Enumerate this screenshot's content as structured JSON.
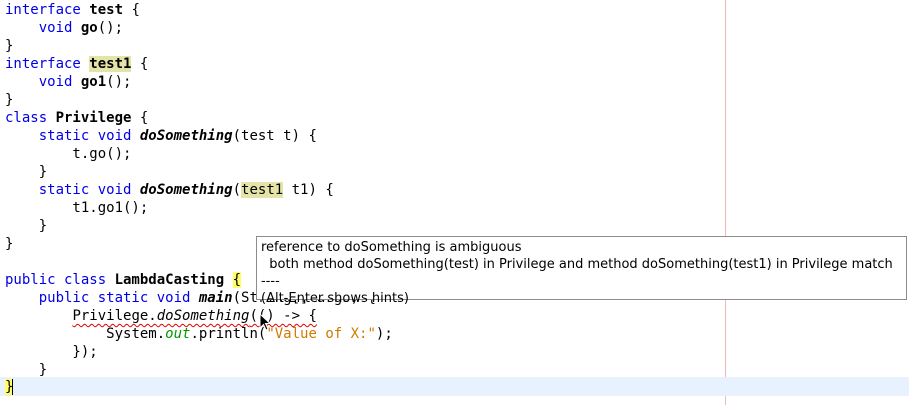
{
  "code": {
    "l1": {
      "kw": "interface ",
      "name": "test",
      "rest": " {"
    },
    "l2": {
      "indent": "    ",
      "kw": "void ",
      "name": "go",
      "rest": "();"
    },
    "l3": {
      "text": "}"
    },
    "l4": {
      "kw": "interface ",
      "name": "test1",
      "rest": " {"
    },
    "l5": {
      "indent": "    ",
      "kw": "void ",
      "name": "go1",
      "rest": "();"
    },
    "l6": {
      "text": "}"
    },
    "l7": {
      "kw": "class ",
      "name": "Privilege",
      "rest": " {"
    },
    "l8": {
      "indent": "    ",
      "kw": "static void ",
      "name": "doSomething",
      "rest": "(test t) {"
    },
    "l9": {
      "text": "        t.go();"
    },
    "l10": {
      "text": "    }"
    },
    "l11": {
      "indent": "    ",
      "kw": "static void ",
      "name": "doSomething",
      "paren": "(",
      "type": "test1",
      "rest": " t1) {"
    },
    "l12": {
      "text": "        t1.go1();"
    },
    "l13": {
      "text": "    }"
    },
    "l14": {
      "text": "}"
    },
    "l16": {
      "kw": "public class ",
      "name": "LambdaCasting",
      "space": " ",
      "brace": "{",
      "tail": ""
    },
    "l17": {
      "indent": "    ",
      "kw": "public static void ",
      "name": "main",
      "rest": "(String[] args) {"
    },
    "l18": {
      "indent": "        ",
      "cls": "Privilege.",
      "method": "doSomething",
      "rest": "(() -> {"
    },
    "l19": {
      "indent": "            ",
      "pre": "System.",
      "field": "out",
      "mid": ".println(",
      "str": "\"Value of X:\"",
      "end": ");"
    },
    "l20": {
      "text": "        });"
    },
    "l21": {
      "text": "    }"
    },
    "l22": {
      "brace": "}"
    }
  },
  "tooltip": {
    "line1": "reference to doSomething is ambiguous",
    "line2": "  both method doSomething(test) in Privilege and method doSomething(test1) in Privilege match",
    "line3": "----",
    "line4": "(Alt-Enter shows hints)"
  },
  "colors": {
    "keyword": "#0000e6",
    "field": "#009900",
    "string": "#ce7b00",
    "occurrence_highlight": "#e4e4a8",
    "brace_match": "#ffff66",
    "current_line": "#e8f2fe",
    "right_margin": "#f2b6b6"
  },
  "icons": {
    "cursor": "mouse-pointer-icon"
  }
}
